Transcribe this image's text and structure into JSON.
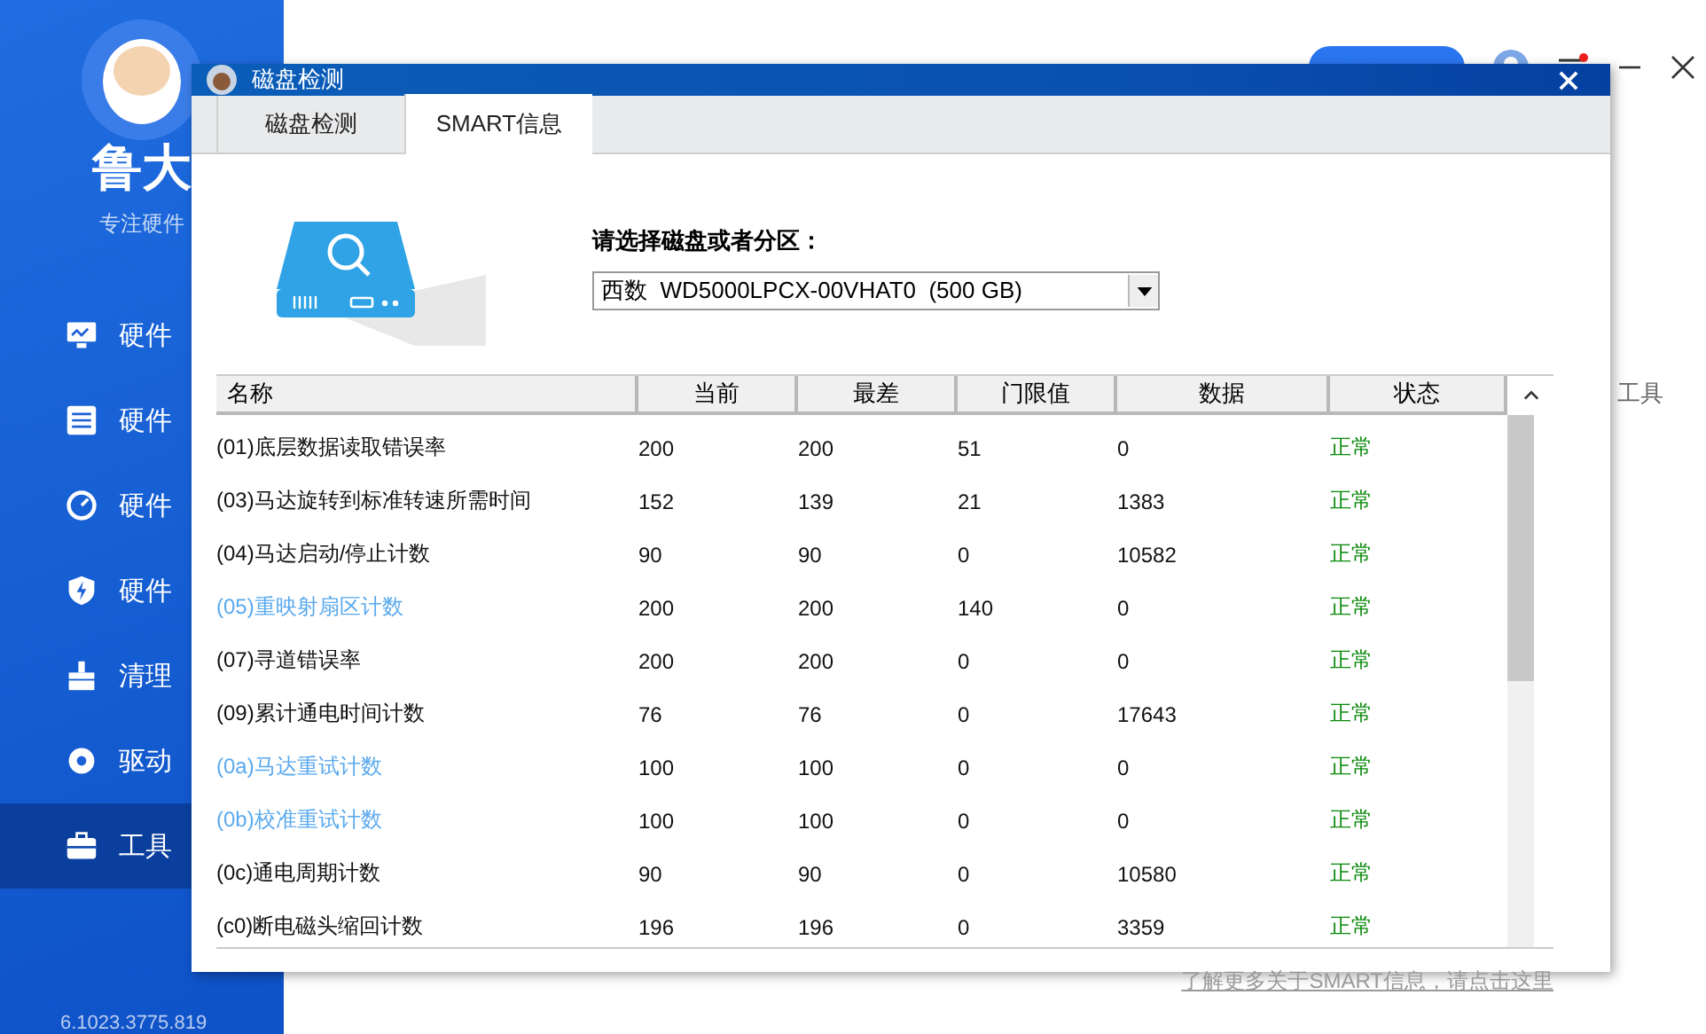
{
  "app": {
    "logo": "鲁大",
    "slogan": "专注硬件",
    "side_hint": "工具",
    "version": "6.1023.3775.819",
    "sidebar": [
      {
        "label": "硬件",
        "selected": false
      },
      {
        "label": "硬件",
        "selected": false
      },
      {
        "label": "硬件",
        "selected": false
      },
      {
        "label": "硬件",
        "selected": false
      },
      {
        "label": "清理",
        "selected": false
      },
      {
        "label": "驱动",
        "selected": false
      },
      {
        "label": "工具",
        "selected": true
      }
    ]
  },
  "dialog": {
    "title": "磁盘检测",
    "tabs": [
      {
        "label": "磁盘检测",
        "selected": false
      },
      {
        "label": "SMART信息",
        "selected": true
      }
    ],
    "disk_label": "请选择磁盘或者分区：",
    "disk_value": "西数  WD5000LPCX-00VHAT0  (500 GB)",
    "columns": [
      "名称",
      "当前",
      "最差",
      "门限值",
      "数据",
      "状态"
    ],
    "rows": [
      {
        "name": "(01)底层数据读取错误率",
        "current": "200",
        "worst": "200",
        "threshold": "51",
        "data": "0",
        "status": "正常",
        "critical": false
      },
      {
        "name": "(03)马达旋转到标准转速所需时间",
        "current": "152",
        "worst": "139",
        "threshold": "21",
        "data": "1383",
        "status": "正常",
        "critical": false
      },
      {
        "name": "(04)马达启动/停止计数",
        "current": "90",
        "worst": "90",
        "threshold": "0",
        "data": "10582",
        "status": "正常",
        "critical": false
      },
      {
        "name": "(05)重映射扇区计数",
        "current": "200",
        "worst": "200",
        "threshold": "140",
        "data": "0",
        "status": "正常",
        "critical": true
      },
      {
        "name": "(07)寻道错误率",
        "current": "200",
        "worst": "200",
        "threshold": "0",
        "data": "0",
        "status": "正常",
        "critical": false
      },
      {
        "name": "(09)累计通电时间计数",
        "current": "76",
        "worst": "76",
        "threshold": "0",
        "data": "17643",
        "status": "正常",
        "critical": false
      },
      {
        "name": "(0a)马达重试计数",
        "current": "100",
        "worst": "100",
        "threshold": "0",
        "data": "0",
        "status": "正常",
        "critical": true
      },
      {
        "name": "(0b)校准重试计数",
        "current": "100",
        "worst": "100",
        "threshold": "0",
        "data": "0",
        "status": "正常",
        "critical": true
      },
      {
        "name": "(0c)通电周期计数",
        "current": "90",
        "worst": "90",
        "threshold": "0",
        "data": "10580",
        "status": "正常",
        "critical": false
      },
      {
        "name": "(c0)断电磁头缩回计数",
        "current": "196",
        "worst": "196",
        "threshold": "0",
        "data": "3359",
        "status": "正常",
        "critical": false
      }
    ],
    "link": "了解更多关于SMART信息，请点击这里"
  }
}
